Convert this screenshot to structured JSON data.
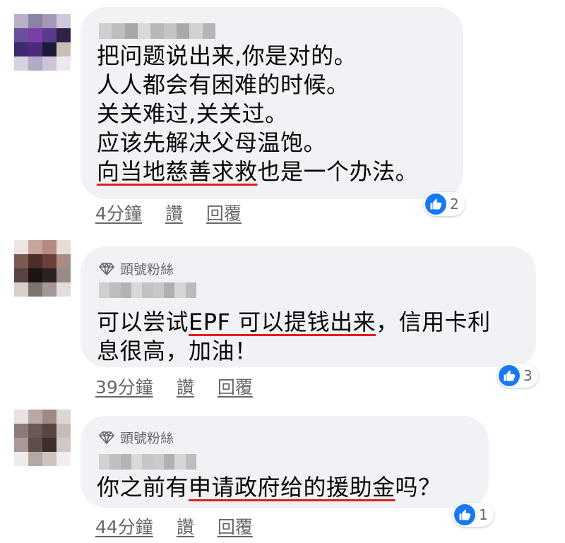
{
  "comments": [
    {
      "avatar_colors": [
        "#b7b0c8",
        "#8c82a6",
        "#a49ab8",
        "#cfc8dd",
        "#6a4f9e",
        "#7a3ea5",
        "#5a3a8c",
        "#2d2347",
        "#3c2c6e",
        "#4b2a7e",
        "#201a3a",
        "#c9c0b5",
        "#d8d2e0",
        "#b2a9c4",
        "#cdc4d9",
        "#ece9f1"
      ],
      "name_colors": [
        "#cfcfcf",
        "#bdbdbd",
        "#a7a7a7",
        "#d9d9d9",
        "#b8b8b8",
        "#c4c4c4",
        "#a9a9a9",
        "#d2d2d2",
        "#b5b5b5"
      ],
      "badge": "",
      "lines": [
        [
          {
            "t": "把问题说出来,你是对的。"
          }
        ],
        [
          {
            "t": "人人都会有困难的时候。"
          }
        ],
        [
          {
            "t": "关关难过,关关过。"
          }
        ],
        [
          {
            "t": "应该先解决父母温饱。"
          }
        ],
        [
          {
            "t": "向当地慈善求救",
            "u": true
          },
          {
            "t": "也是一个办法。"
          }
        ]
      ],
      "reactions": "2",
      "time": "4分鐘",
      "like_label": "讚",
      "reply_label": "回覆"
    },
    {
      "avatar_colors": [
        "#ede5e2",
        "#c9a49b",
        "#b48a82",
        "#e6dcd8",
        "#7a5a52",
        "#4a2f2a",
        "#6b4038",
        "#a98d85",
        "#5a4440",
        "#1c1514",
        "#2e2220",
        "#9a8a88",
        "#d8cfcd",
        "#7f7370",
        "#a39896",
        "#e2dcdb"
      ],
      "name_colors": [
        "#cfcfcf",
        "#bdbdbd",
        "#b3b3b3",
        "#d9d9d9",
        "#c2c2c2",
        "#c8c8c8",
        "#b0b0b0",
        "#d6d6d6",
        "#bcbcbc"
      ],
      "badge": "頭號粉絲",
      "lines": [
        [
          {
            "t": "可以尝试"
          },
          {
            "t": "EPF 可以提钱出来",
            "u": true
          },
          {
            "t": "，信用卡利"
          }
        ],
        [
          {
            "t": "息很高，加油！"
          }
        ]
      ],
      "reactions": "3",
      "time": "39分鐘",
      "like_label": "讚",
      "reply_label": "回覆"
    },
    {
      "avatar_colors": [
        "#e8e3e2",
        "#b9a9a6",
        "#9e8985",
        "#dcd6d5",
        "#8e7b78",
        "#6a5854",
        "#57463f",
        "#c8bcb9",
        "#a89996",
        "#5e4f4b",
        "#3d302c",
        "#d1c7c5",
        "#efebea",
        "#b4a8a5",
        "#cdc3c1",
        "#f1eeed"
      ],
      "name_colors": [
        "#d2d2d2",
        "#c0c0c0",
        "#b4b4b4",
        "#dadada",
        "#c6c6c6",
        "#cacaca",
        "#b1b1b1",
        "#d6d6d6",
        "#bdbdbd"
      ],
      "badge": "頭號粉絲",
      "lines": [
        [
          {
            "t": "你之前有"
          },
          {
            "t": "申请政府给的援助金",
            "u": true
          },
          {
            "t": "吗？"
          }
        ]
      ],
      "reactions": "1",
      "time": "44分鐘",
      "like_label": "讚",
      "reply_label": "回覆"
    }
  ]
}
